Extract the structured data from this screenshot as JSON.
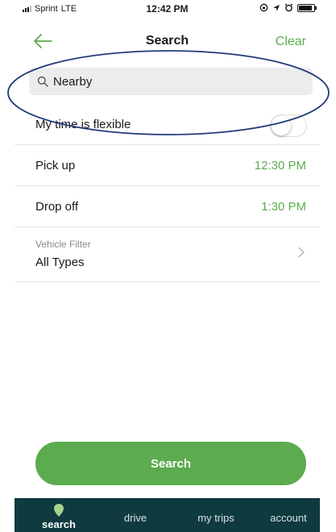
{
  "status_bar": {
    "carrier": "Sprint",
    "network": "LTE",
    "time": "12:42 PM"
  },
  "nav": {
    "title": "Search",
    "clear_label": "Clear"
  },
  "search": {
    "value": "Nearby"
  },
  "flexible": {
    "label": "My time is flexible",
    "enabled": false
  },
  "pickup": {
    "label": "Pick up",
    "value": "12:30 PM"
  },
  "dropoff": {
    "label": "Drop off",
    "value": "1:30 PM"
  },
  "vehicle_filter": {
    "label": "Vehicle Filter",
    "value": "All Types"
  },
  "search_button_label": "Search",
  "tabs": [
    {
      "label": "search",
      "active": true
    },
    {
      "label": "drive",
      "active": false
    },
    {
      "label": "my trips",
      "active": false
    },
    {
      "label": "account",
      "active": false
    }
  ],
  "colors": {
    "accent": "#5cab4f",
    "tabbar": "#0f3a3f",
    "annotation": "#1f3b78"
  }
}
